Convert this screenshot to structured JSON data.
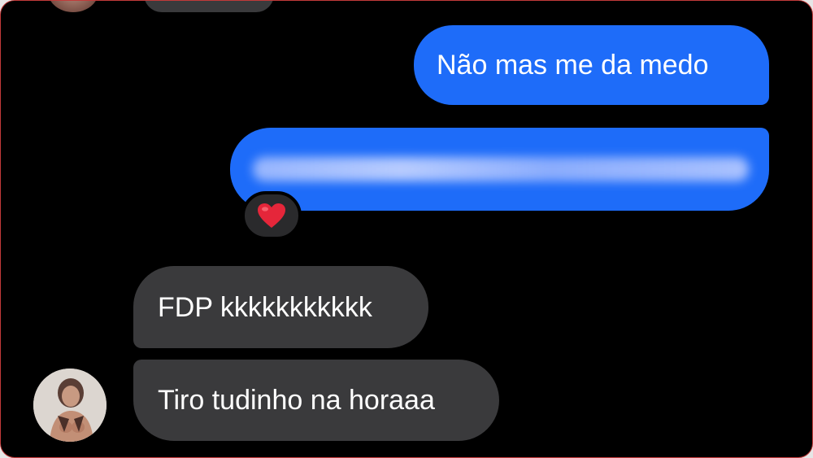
{
  "messages": {
    "sent_1": "Não mas me da medo",
    "sent_2_reaction": "❤️",
    "received_1": "FDP kkkkkkkkkkk",
    "received_2": "Tiro tudinho na horaaa"
  },
  "colors": {
    "background": "#000000",
    "sent_bubble": "#1e6cf9",
    "received_bubble": "#3a3a3c",
    "frame_border": "#c23a3a"
  },
  "icons": {
    "reaction": "red-heart-icon"
  }
}
